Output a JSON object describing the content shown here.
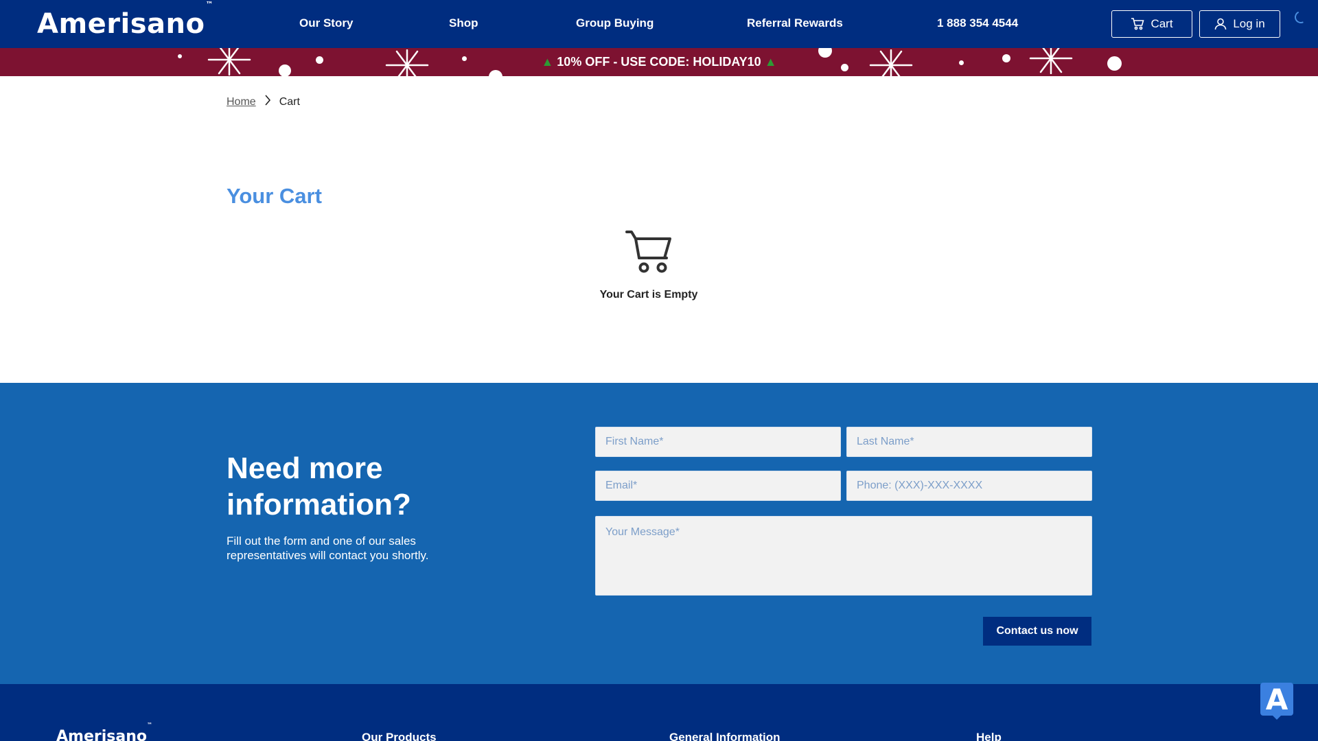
{
  "header": {
    "logo": "Amerisano",
    "logo_mark": "™",
    "nav": [
      "Our Story",
      "Shop",
      "Group Buying",
      "Referral Rewards",
      "1 888 354 4544"
    ],
    "cart_label": "Cart",
    "login_label": "Log in"
  },
  "promo": {
    "text": "10% OFF - USE CODE: HOLIDAY10",
    "icon": "christmas-tree"
  },
  "breadcrumb": {
    "home": "Home",
    "current": "Cart"
  },
  "cart": {
    "title": "Your Cart",
    "empty_message": "Your Cart is Empty",
    "icon": "shopping-cart-icon"
  },
  "contact": {
    "heading_line1": "Need more",
    "heading_line2": "information?",
    "subtext": "Fill out the form and one of our sales representatives will contact you shortly.",
    "first_name_placeholder": "First Name*",
    "last_name_placeholder": "Last Name*",
    "email_placeholder": "Email*",
    "phone_placeholder": "Phone: (XXX)-XXX-XXXX",
    "message_placeholder": "Your Message*",
    "submit_label": "Contact us now"
  },
  "footer": {
    "logo": "Amerisano",
    "logo_mark": "™",
    "columns": [
      "Our Products",
      "General Information",
      "Help"
    ]
  },
  "widget": {
    "letter": "A"
  },
  "colors": {
    "header_bg": "#002d80",
    "promo_bg": "#7d1231",
    "accent_blue": "#4a8fe0",
    "contact_bg": "#1565b0"
  }
}
